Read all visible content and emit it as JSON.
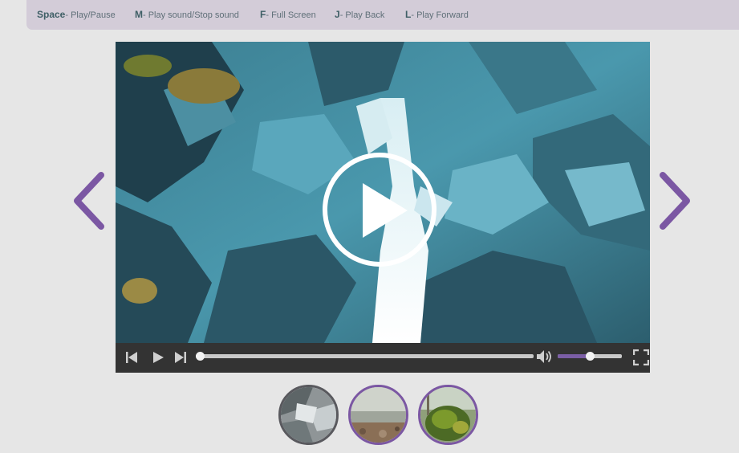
{
  "shortcuts": [
    {
      "key": "Space",
      "desc": "- Play/Pause"
    },
    {
      "key": "M",
      "desc": "- Play sound/Stop sound"
    },
    {
      "key": "F",
      "desc": "- Full Screen"
    },
    {
      "key": "J",
      "desc": "- Play Back"
    },
    {
      "key": "L",
      "desc": "- Play Forward"
    }
  ],
  "colors": {
    "accent": "#7b57a3",
    "shortcut_bar": "#d3ccd8",
    "control_bar": "#333333",
    "background": "#e6e6e6"
  },
  "icons": {
    "prev": "chevron-left-icon",
    "next": "chevron-right-icon",
    "play_overlay": "play-circle-icon",
    "skip_back": "skip-back-icon",
    "play": "play-icon",
    "skip_forward": "skip-forward-icon",
    "volume": "volume-icon",
    "fullscreen": "fullscreen-icon"
  },
  "player": {
    "progress_fraction": 0.0,
    "volume_fraction": 0.5
  },
  "thumbnails": [
    {
      "name": "thumbnail-rocky-stream",
      "active": true
    },
    {
      "name": "thumbnail-pebble-shore",
      "active": false
    },
    {
      "name": "thumbnail-mossy-forest",
      "active": false
    }
  ]
}
